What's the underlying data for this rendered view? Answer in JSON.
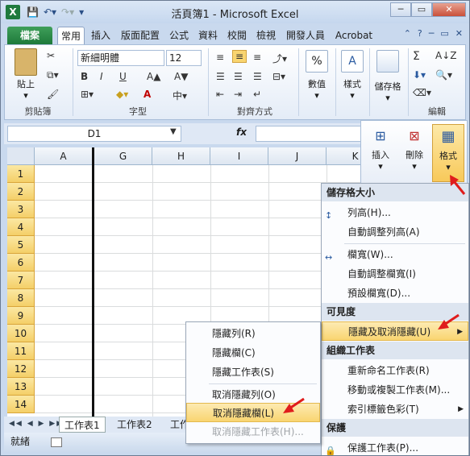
{
  "app": {
    "title": "活頁簿1 - Microsoft Excel",
    "logo": "X"
  },
  "window_controls": {
    "minimize": "─",
    "restore": "▭",
    "close": "✕"
  },
  "tabs": [
    "檔案",
    "常用",
    "插入",
    "版面配置",
    "公式",
    "資料",
    "校閱",
    "檢視",
    "開發人員",
    "Acrobat"
  ],
  "ribbon": {
    "clipboard": {
      "paste": "貼上",
      "label": "剪貼簿"
    },
    "font": {
      "name": "新細明體",
      "size": "12",
      "label": "字型",
      "bold": "B",
      "italic": "I",
      "underline": "U",
      "grow": "A▲",
      "shrink": "A▼",
      "fontcolor": "A"
    },
    "alignment": {
      "label": "對齊方式"
    },
    "number": {
      "btn": "數值",
      "symbol": "%"
    },
    "styles": {
      "btn": "樣式"
    },
    "cells": {
      "btn": "儲存格"
    },
    "editing": {
      "label": "編輯",
      "sum": "Σ",
      "sort": "A↓Z"
    }
  },
  "formula_bar": {
    "namebox": "D1",
    "fx": "fx"
  },
  "cells_group": {
    "insert": "插入",
    "delete": "刪除",
    "format": "格式"
  },
  "grid": {
    "columns": [
      "A",
      "G",
      "H",
      "I",
      "J",
      "K"
    ],
    "rows": [
      "1",
      "2",
      "3",
      "4",
      "5",
      "6",
      "7",
      "8",
      "9",
      "10",
      "11",
      "12",
      "13",
      "14"
    ]
  },
  "sheets": [
    "工作表1",
    "工作表2",
    "工作"
  ],
  "status": {
    "ready": "就緒"
  },
  "format_menu": {
    "cellsize_header": "儲存格大小",
    "row_height": "列高(H)...",
    "autofit_row": "自動調整列高(A)",
    "col_width": "欄寬(W)...",
    "autofit_col": "自動調整欄寬(I)",
    "default_width": "預設欄寬(D)...",
    "visibility_header": "可見度",
    "hide_unhide": "隱藏及取消隱藏(U)",
    "organize_header": "組織工作表",
    "rename": "重新命名工作表(R)",
    "move_copy": "移動或複製工作表(M)...",
    "tab_color": "索引標籤色彩(T)",
    "protect_header": "保護",
    "protect_sheet": "保護工作表(P)..."
  },
  "hide_submenu": {
    "hide_rows": "隱藏列(R)",
    "hide_cols": "隱藏欄(C)",
    "hide_sheet": "隱藏工作表(S)",
    "unhide_rows": "取消隱藏列(O)",
    "unhide_cols": "取消隱藏欄(L)",
    "unhide_sheet": "取消隱藏工作表(H)..."
  },
  "colors": {
    "accent": "#f9d570",
    "file_tab": "#1e7a3a",
    "arrow": "#e01c1c"
  }
}
